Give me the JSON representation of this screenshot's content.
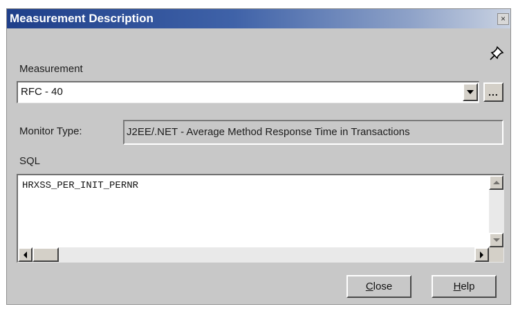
{
  "dialog": {
    "title": "Measurement Description",
    "close_glyph": "×"
  },
  "measurement": {
    "label": "Measurement",
    "value": "RFC - 40",
    "browse_label": "..."
  },
  "monitor_type": {
    "label": "Monitor Type:",
    "value": "J2EE/.NET - Average Method Response Time in Transactions"
  },
  "sql": {
    "label": "SQL",
    "value": "HRXSS_PER_INIT_PERNR"
  },
  "buttons": {
    "close_label": "Close",
    "help_label": "Help"
  },
  "icons": {
    "pin": "pin-icon",
    "dropdown": "chevron-down-icon"
  },
  "colors": {
    "title_bar_start": "#1f3f8a",
    "dialog_background": "#c8c8c8"
  }
}
